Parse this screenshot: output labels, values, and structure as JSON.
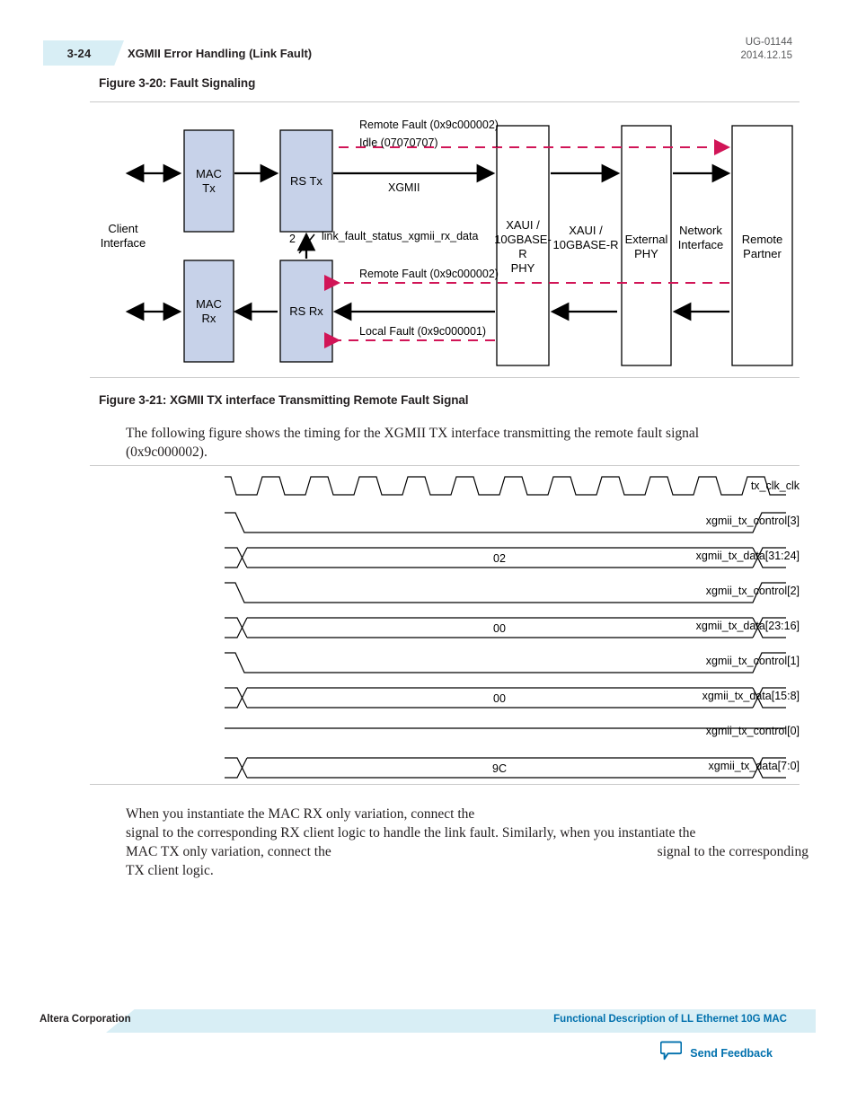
{
  "header": {
    "page_number": "3-24",
    "title": "XGMII Error Handling (Link Fault)",
    "doc_id": "UG-01144",
    "doc_date": "2014.12.15"
  },
  "figure_320": {
    "caption": "Figure 3-20: Fault Signaling",
    "client_interface_label": "Client\nInterface",
    "blocks": [
      {
        "id": "mac-tx",
        "label": "MAC\nTx"
      },
      {
        "id": "rs-tx",
        "label": "RS Tx"
      },
      {
        "id": "mac-rx",
        "label": "MAC\nRx"
      },
      {
        "id": "rs-rx",
        "label": "RS Rx"
      },
      {
        "id": "xaui-phy",
        "label": "XAUI /\n10GBASE-R\nPHY"
      },
      {
        "id": "external-phy",
        "label": "External\nPHY"
      },
      {
        "id": "remote-partner",
        "label": "Remote\nPartner"
      }
    ],
    "channel_labels": [
      {
        "id": "xaui-10gbaser",
        "label": "XAUI /\n10GBASE-R"
      },
      {
        "id": "network-interface",
        "label": "Network\nInterface"
      }
    ],
    "annotations": {
      "remote_fault_top": "Remote Fault (0x9c000002)",
      "idle": "Idle (07070707)",
      "xgmii": "XGMII",
      "link_fault_status": "link_fault_status_xgmii_rx_data",
      "bus_width": "2",
      "remote_fault_rx": "Remote Fault (0x9c000002)",
      "local_fault_rx": "Local Fault (0x9c000001)"
    },
    "colors": {
      "block_fill": "#c7d2e9",
      "fault_line": "#d11557"
    }
  },
  "figure_321": {
    "caption": "Figure 3-21: XGMII TX interface Transmitting Remote Fault Signal",
    "intro_text": "The following figure shows the timing for the XGMII TX interface transmitting the remote fault signal (0x9c000002).",
    "signals": [
      {
        "name": "tx_clk_clk",
        "type": "clock"
      },
      {
        "name": "xgmii_tx_control[3]",
        "type": "control",
        "value": ""
      },
      {
        "name": "xgmii_tx_data[31:24]",
        "type": "data",
        "value": "02"
      },
      {
        "name": "xgmii_tx_control[2]",
        "type": "control",
        "value": ""
      },
      {
        "name": "xgmii_tx_data[23:16]",
        "type": "data",
        "value": "00"
      },
      {
        "name": "xgmii_tx_control[1]",
        "type": "control",
        "value": ""
      },
      {
        "name": "xgmii_tx_data[15:8]",
        "type": "data",
        "value": "00"
      },
      {
        "name": "xgmii_tx_control[0]",
        "type": "flat",
        "value": ""
      },
      {
        "name": "xgmii_tx_data[7:0]",
        "type": "data",
        "value": "9C"
      }
    ]
  },
  "closing_text": {
    "line1": "When you instantiate the MAC RX only variation, connect the",
    "line2": "signal to the corresponding RX client logic to handle the link fault. Similarly, when you instantiate the",
    "line3_a": "MAC TX only variation, connect the",
    "line3_b": "signal to the corresponding",
    "line4": "TX client logic."
  },
  "footer": {
    "left": "Altera Corporation",
    "right": "Functional Description of LL Ethernet 10G MAC",
    "feedback": "Send Feedback",
    "link_color": "#0070ad"
  }
}
